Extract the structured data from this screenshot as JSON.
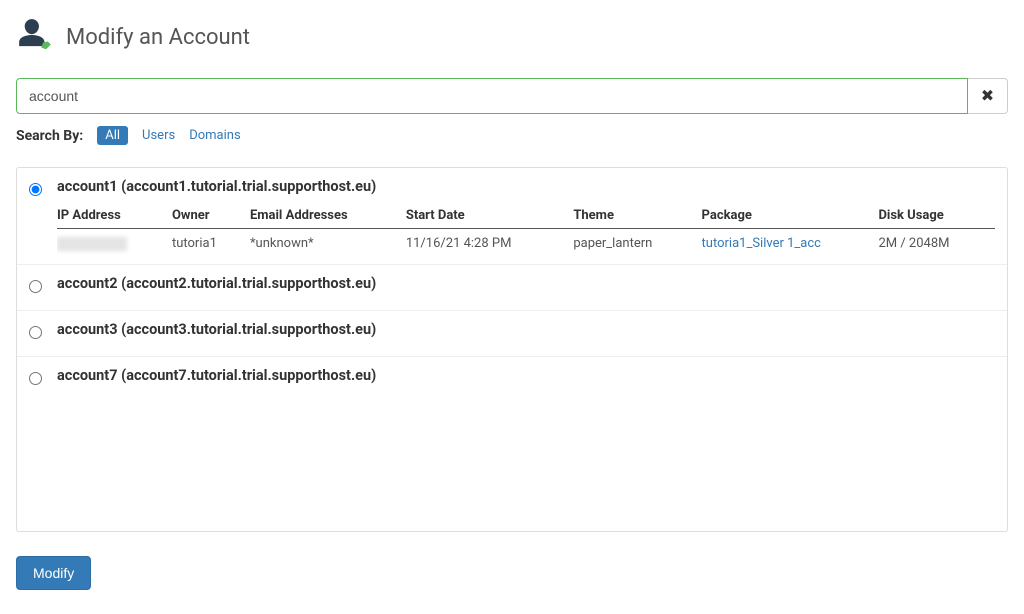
{
  "page": {
    "title": "Modify an Account"
  },
  "search": {
    "value": "account",
    "by_label": "Search By:",
    "filter_all": "All",
    "filter_users": "Users",
    "filter_domains": "Domains"
  },
  "table_headers": {
    "ip": "IP Address",
    "owner": "Owner",
    "email": "Email Addresses",
    "start": "Start Date",
    "theme": "Theme",
    "package": "Package",
    "disk": "Disk Usage"
  },
  "accounts": [
    {
      "title": "account1 (account1.tutorial.trial.supporthost.eu)",
      "selected": true,
      "details": {
        "ip": "",
        "owner": "tutoria1",
        "email": "*unknown*",
        "start": "11/16/21 4:28 PM",
        "theme": "paper_lantern",
        "package": "tutoria1_Silver 1_acc",
        "disk": "2M / 2048M"
      }
    },
    {
      "title": "account2 (account2.tutorial.trial.supporthost.eu)",
      "selected": false
    },
    {
      "title": "account3 (account3.tutorial.trial.supporthost.eu)",
      "selected": false
    },
    {
      "title": "account7 (account7.tutorial.trial.supporthost.eu)",
      "selected": false
    }
  ],
  "buttons": {
    "modify": "Modify"
  }
}
